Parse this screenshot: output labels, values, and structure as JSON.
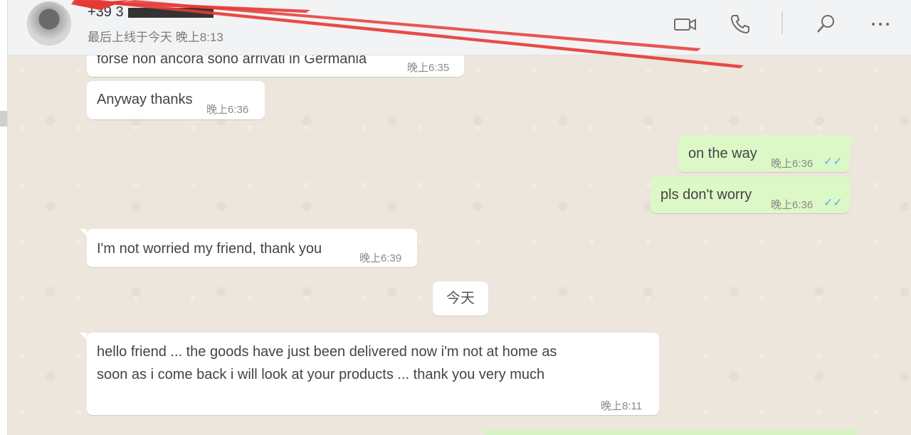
{
  "header": {
    "contact_name": "+39 3",
    "last_seen": "最后上线于今天 晚上8:13",
    "icons": [
      "video-call-icon",
      "phone-icon",
      "search-icon",
      "more-icon"
    ]
  },
  "messages": [
    {
      "text": "forse non ancora sono arrivati  in Germania",
      "time": "晚上6:35"
    },
    {
      "text": "Anyway thanks",
      "time": "晚上6:36"
    },
    {
      "text": "on the way",
      "time": "晚上6:36"
    },
    {
      "text": "pls don't worry",
      "time": "晚上6:36"
    },
    {
      "text": "I'm not worried my friend, thank you",
      "time": "晚上6:39"
    },
    {
      "text_line1": "hello friend ... the goods have just been delivered now i'm not at home as",
      "text_line2": "soon as i come back i will look at your products ... thank you very much",
      "time": "晚上8:11"
    }
  ],
  "date_separator": "今天",
  "colors": {
    "incoming_bubble": "#ffffff",
    "outgoing_bubble": "#dcf8c6",
    "read_tick": "#4fb6ec",
    "annotation_arrow": "#e53935"
  }
}
